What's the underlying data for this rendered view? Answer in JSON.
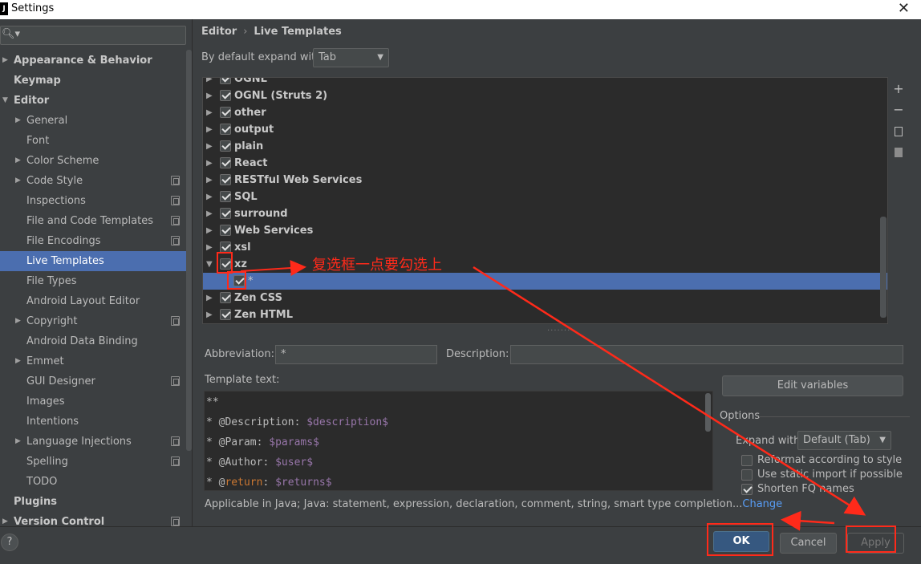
{
  "window": {
    "title": "Settings",
    "close_glyph": "✕",
    "app_icon": "J"
  },
  "search": {
    "placeholder": "",
    "icon": "search-icon"
  },
  "nav": {
    "items": [
      {
        "label": "Appearance & Behavior",
        "level": 0,
        "arrow": "right",
        "bold": true
      },
      {
        "label": "Keymap",
        "level": 0,
        "bold": true
      },
      {
        "label": "Editor",
        "level": 0,
        "arrow": "down",
        "bold": true
      },
      {
        "label": "General",
        "level": 1,
        "arrow": "right"
      },
      {
        "label": "Font",
        "level": 1
      },
      {
        "label": "Color Scheme",
        "level": 1,
        "arrow": "right"
      },
      {
        "label": "Code Style",
        "level": 1,
        "arrow": "right",
        "copy": true
      },
      {
        "label": "Inspections",
        "level": 1,
        "copy": true
      },
      {
        "label": "File and Code Templates",
        "level": 1,
        "copy": true
      },
      {
        "label": "File Encodings",
        "level": 1,
        "copy": true
      },
      {
        "label": "Live Templates",
        "level": 1,
        "selected": true
      },
      {
        "label": "File Types",
        "level": 1
      },
      {
        "label": "Android Layout Editor",
        "level": 1
      },
      {
        "label": "Copyright",
        "level": 1,
        "arrow": "right",
        "copy": true
      },
      {
        "label": "Android Data Binding",
        "level": 1
      },
      {
        "label": "Emmet",
        "level": 1,
        "arrow": "right"
      },
      {
        "label": "GUI Designer",
        "level": 1,
        "copy": true
      },
      {
        "label": "Images",
        "level": 1
      },
      {
        "label": "Intentions",
        "level": 1
      },
      {
        "label": "Language Injections",
        "level": 1,
        "arrow": "right",
        "copy": true
      },
      {
        "label": "Spelling",
        "level": 1,
        "copy": true
      },
      {
        "label": "TODO",
        "level": 1
      },
      {
        "label": "Plugins",
        "level": 0,
        "bold": true
      },
      {
        "label": "Version Control",
        "level": 0,
        "arrow": "right",
        "bold": true,
        "copy": true
      }
    ]
  },
  "breadcrumb": {
    "parent": "Editor",
    "separator": "›",
    "current": "Live Templates"
  },
  "expand_default": {
    "label": "By default expand with",
    "value": "Tab"
  },
  "tree": {
    "rows": [
      {
        "label": "OGNL",
        "level": 0,
        "checked": true,
        "expanded": false,
        "partial": true
      },
      {
        "label": "OGNL (Struts 2)",
        "level": 0,
        "checked": true,
        "expanded": false
      },
      {
        "label": "other",
        "level": 0,
        "checked": true,
        "expanded": false
      },
      {
        "label": "output",
        "level": 0,
        "checked": true,
        "expanded": false
      },
      {
        "label": "plain",
        "level": 0,
        "checked": true,
        "expanded": false
      },
      {
        "label": "React",
        "level": 0,
        "checked": true,
        "expanded": false
      },
      {
        "label": "RESTful Web Services",
        "level": 0,
        "checked": true,
        "expanded": false
      },
      {
        "label": "SQL",
        "level": 0,
        "checked": true,
        "expanded": false
      },
      {
        "label": "surround",
        "level": 0,
        "checked": true,
        "expanded": false
      },
      {
        "label": "Web Services",
        "level": 0,
        "checked": true,
        "expanded": false
      },
      {
        "label": "xsl",
        "level": 0,
        "checked": true,
        "expanded": false
      },
      {
        "label": "xz",
        "level": 0,
        "checked": true,
        "expanded": true
      },
      {
        "label": "*",
        "level": 1,
        "checked": true,
        "selected": true
      },
      {
        "label": "Zen CSS",
        "level": 0,
        "checked": true,
        "expanded": false
      },
      {
        "label": "Zen HTML",
        "level": 0,
        "checked": true,
        "expanded": false
      }
    ]
  },
  "tools": {
    "add": "+",
    "remove": "−",
    "copy_icon": "copy-icon",
    "edit_icon": "template-icon"
  },
  "abbreviation": {
    "label": "Abbreviation:",
    "value": "*"
  },
  "description": {
    "label": "Description:",
    "value": ""
  },
  "template_text": {
    "label": "Template text:",
    "lines": [
      [
        {
          "t": "**",
          "c": "tag"
        }
      ],
      [
        {
          "t": "* @Description: ",
          "c": "tag"
        },
        {
          "t": "$description$",
          "c": "var"
        }
      ],
      [
        {
          "t": "* @Param: ",
          "c": "tag"
        },
        {
          "t": "$params$",
          "c": "var"
        }
      ],
      [
        {
          "t": "* @Author: ",
          "c": "tag"
        },
        {
          "t": "$user$",
          "c": "var"
        }
      ],
      [
        {
          "t": "* @",
          "c": "tag"
        },
        {
          "t": "return",
          "c": "kw"
        },
        {
          "t": ": ",
          "c": "tag"
        },
        {
          "t": "$returns$",
          "c": "var"
        }
      ]
    ]
  },
  "edit_variables": {
    "label": "Edit variables"
  },
  "options": {
    "title": "Options",
    "expand_label": "Expand with",
    "expand_value": "Default (Tab)",
    "checkboxes": [
      {
        "label": "Reformat according to style",
        "checked": false
      },
      {
        "label": "Use static import if possible",
        "checked": false
      },
      {
        "label": "Shorten FQ names",
        "checked": true
      }
    ]
  },
  "applicable": {
    "text": "Applicable in Java; Java: statement, expression, declaration, comment, string, smart type completion...",
    "link": "Change"
  },
  "footer": {
    "help": "?",
    "ok": "OK",
    "cancel": "Cancel",
    "apply": "Apply"
  },
  "annotation": {
    "text": "复选框一点要勾选上",
    "color": "#ff2a1a"
  }
}
